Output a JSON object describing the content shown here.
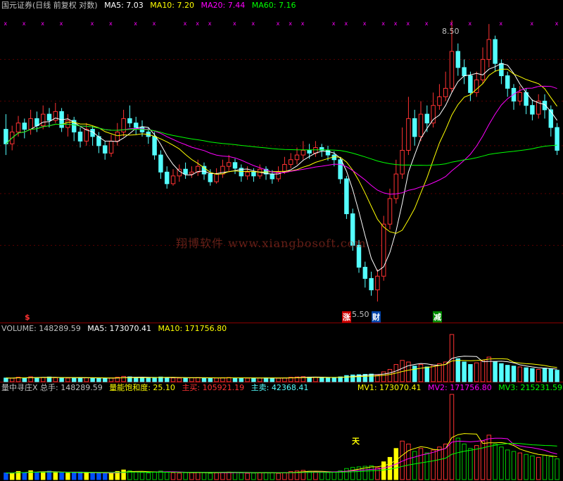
{
  "main_header": {
    "title": "国元证券(日线 前复权 对数)",
    "ma5": "MA5: 7.03",
    "ma10": "MA10: 7.20",
    "ma20": "MA20: 7.44",
    "ma60": "MA60: 7.16"
  },
  "volume_header": {
    "title": "VOLUME: 148289.59",
    "ma5": "MA5: 173070.41",
    "ma10": "MA10: 171756.80"
  },
  "indicator_header": {
    "title": "量中寻庄X 总手: 148289.59",
    "saturation": "量能饱和度: 25.10",
    "main_buy": "主买: 105921.19",
    "main_sell": "主卖: 42368.41",
    "mv1": "MV1: 173070.41",
    "mv2": "MV2: 171756.80",
    "mv3": "MV3: 215231.59"
  },
  "annotations": {
    "high_label": "8.50",
    "low_label": "5.50",
    "mark_s": "$",
    "mark_zhang": "涨",
    "mark_cai": "财",
    "mark_jian": "减",
    "mark_tian": "天"
  },
  "watermark": "翔博软件 www.xiangbosoft.com",
  "colors": {
    "up": "#ff3232",
    "down": "#54ffff",
    "ma5": "#ffffff",
    "ma10": "#ffff00",
    "ma20": "#ff00ff",
    "ma60": "#00ff00",
    "background": "#000000"
  },
  "chart_data": {
    "type": "candlestick",
    "price_range": [
      5.4,
      8.6
    ],
    "candles": [
      [
        7.18,
        7.02,
        7.35,
        6.9
      ],
      [
        7.02,
        7.15,
        7.22,
        6.95
      ],
      [
        7.15,
        7.25,
        7.33,
        7.1
      ],
      [
        7.25,
        7.18,
        7.3,
        7.08
      ],
      [
        7.18,
        7.3,
        7.4,
        7.12
      ],
      [
        7.3,
        7.22,
        7.38,
        7.15
      ],
      [
        7.22,
        7.35,
        7.45,
        7.18
      ],
      [
        7.35,
        7.28,
        7.42,
        7.2
      ],
      [
        7.28,
        7.38,
        7.48,
        7.25
      ],
      [
        7.38,
        7.2,
        7.42,
        7.15
      ],
      [
        7.2,
        7.28,
        7.35,
        7.1
      ],
      [
        7.28,
        7.15,
        7.32,
        7.05
      ],
      [
        7.15,
        7.05,
        7.2,
        6.98
      ],
      [
        7.05,
        7.18,
        7.25,
        7.0
      ],
      [
        7.18,
        7.1,
        7.22,
        7.0
      ],
      [
        7.1,
        7.0,
        7.15,
        6.92
      ],
      [
        7.0,
        6.92,
        7.05,
        6.85
      ],
      [
        6.92,
        7.05,
        7.12,
        6.88
      ],
      [
        7.05,
        7.15,
        7.25,
        7.0
      ],
      [
        7.15,
        7.3,
        7.4,
        7.1
      ],
      [
        7.3,
        7.25,
        7.45,
        7.2
      ],
      [
        7.25,
        7.2,
        7.32,
        7.12
      ],
      [
        7.2,
        7.15,
        7.28,
        7.1
      ],
      [
        7.15,
        7.1,
        7.2,
        7.02
      ],
      [
        7.1,
        6.9,
        7.15,
        6.85
      ],
      [
        6.9,
        6.72,
        6.95,
        6.65
      ],
      [
        6.72,
        6.6,
        6.78,
        6.55
      ],
      [
        6.6,
        6.68,
        6.75,
        6.58
      ],
      [
        6.68,
        6.75,
        6.8,
        6.62
      ],
      [
        6.75,
        6.7,
        6.82,
        6.65
      ],
      [
        6.7,
        6.72,
        6.78,
        6.66
      ],
      [
        6.72,
        6.78,
        6.85,
        6.68
      ],
      [
        6.78,
        6.7,
        6.82,
        6.64
      ],
      [
        6.7,
        6.62,
        6.75,
        6.58
      ],
      [
        6.62,
        6.7,
        6.76,
        6.6
      ],
      [
        6.7,
        6.78,
        6.85,
        6.66
      ],
      [
        6.78,
        6.82,
        6.9,
        6.72
      ],
      [
        6.82,
        6.76,
        6.86,
        6.7
      ],
      [
        6.76,
        6.68,
        6.8,
        6.62
      ],
      [
        6.68,
        6.72,
        6.78,
        6.64
      ],
      [
        6.72,
        6.68,
        6.76,
        6.62
      ],
      [
        6.68,
        6.75,
        6.8,
        6.65
      ],
      [
        6.75,
        6.7,
        6.78,
        6.64
      ],
      [
        6.7,
        6.65,
        6.74,
        6.6
      ],
      [
        6.65,
        6.72,
        6.78,
        6.62
      ],
      [
        6.72,
        6.8,
        6.88,
        6.7
      ],
      [
        6.8,
        6.85,
        6.92,
        6.76
      ],
      [
        6.85,
        6.9,
        6.98,
        6.8
      ],
      [
        6.9,
        6.95,
        7.05,
        6.85
      ],
      [
        6.95,
        6.92,
        7.02,
        6.86
      ],
      [
        6.92,
        6.98,
        7.05,
        6.88
      ],
      [
        6.98,
        6.95,
        7.02,
        6.88
      ],
      [
        6.95,
        6.9,
        7.0,
        6.84
      ],
      [
        6.9,
        6.85,
        6.94,
        6.78
      ],
      [
        6.85,
        6.65,
        6.88,
        6.6
      ],
      [
        6.65,
        6.3,
        6.68,
        6.25
      ],
      [
        6.3,
        6.0,
        6.35,
        5.95
      ],
      [
        6.0,
        5.8,
        6.05,
        5.75
      ],
      [
        5.8,
        5.7,
        5.85,
        5.62
      ],
      [
        5.7,
        5.6,
        5.76,
        5.55
      ],
      [
        5.6,
        5.72,
        5.78,
        5.5
      ],
      [
        5.72,
        6.2,
        6.28,
        5.68
      ],
      [
        6.2,
        6.45,
        6.55,
        6.15
      ],
      [
        6.45,
        6.7,
        6.85,
        6.4
      ],
      [
        6.7,
        6.95,
        7.2,
        6.65
      ],
      [
        6.95,
        7.3,
        7.55,
        6.9
      ],
      [
        7.3,
        7.1,
        7.4,
        7.0
      ],
      [
        7.1,
        7.35,
        7.5,
        7.05
      ],
      [
        7.35,
        7.25,
        7.45,
        7.15
      ],
      [
        7.25,
        7.45,
        7.6,
        7.2
      ],
      [
        7.45,
        7.55,
        7.7,
        7.4
      ],
      [
        7.55,
        7.65,
        7.85,
        7.5
      ],
      [
        7.65,
        8.1,
        8.5,
        7.6
      ],
      [
        8.1,
        7.9,
        8.2,
        7.8
      ],
      [
        7.9,
        7.8,
        8.0,
        7.7
      ],
      [
        7.8,
        7.6,
        7.85,
        7.5
      ],
      [
        7.6,
        7.75,
        7.85,
        7.55
      ],
      [
        7.75,
        8.0,
        8.15,
        7.7
      ],
      [
        8.0,
        8.25,
        8.45,
        7.9
      ],
      [
        8.25,
        7.95,
        8.3,
        7.85
      ],
      [
        7.95,
        7.8,
        8.0,
        7.7
      ],
      [
        7.8,
        7.65,
        7.85,
        7.55
      ],
      [
        7.65,
        7.5,
        7.7,
        7.4
      ],
      [
        7.5,
        7.6,
        7.68,
        7.45
      ],
      [
        7.6,
        7.45,
        7.65,
        7.35
      ],
      [
        7.45,
        7.35,
        7.52,
        7.28
      ],
      [
        7.35,
        7.5,
        7.58,
        7.3
      ],
      [
        7.5,
        7.4,
        7.58,
        7.3
      ],
      [
        7.4,
        7.2,
        7.45,
        7.1
      ],
      [
        7.2,
        6.95,
        7.25,
        6.9
      ]
    ],
    "volume": [
      90,
      85,
      110,
      95,
      120,
      100,
      105,
      115,
      98,
      92,
      88,
      96,
      102,
      94,
      90,
      85,
      80,
      92,
      110,
      130,
      118,
      102,
      96,
      90,
      105,
      115,
      98,
      92,
      88,
      94,
      96,
      100,
      92,
      86,
      90,
      98,
      102,
      95,
      90,
      86,
      88,
      92,
      96,
      90,
      85,
      94,
      108,
      116,
      124,
      112,
      106,
      100,
      95,
      104,
      118,
      150,
      165,
      172,
      180,
      186,
      160,
      240,
      300,
      420,
      520,
      480,
      380,
      420,
      360,
      400,
      440,
      480,
      1150,
      560,
      480,
      420,
      460,
      520,
      600,
      480,
      440,
      400,
      380,
      360,
      340,
      320,
      300,
      330,
      310,
      280
    ]
  }
}
